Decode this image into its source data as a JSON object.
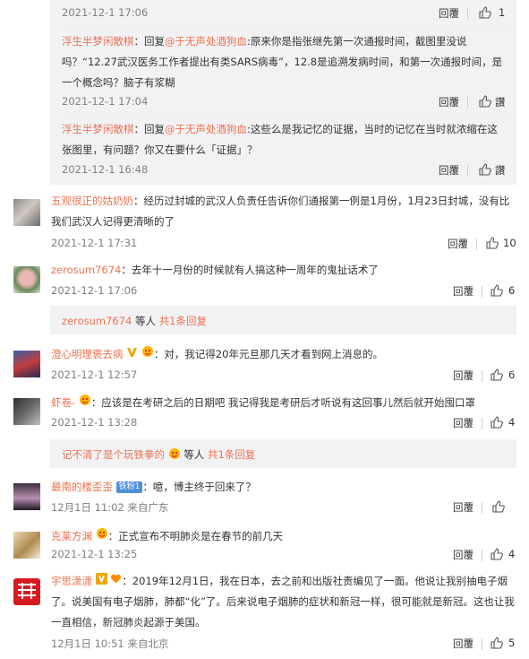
{
  "labels": {
    "reply": "回覆",
    "reply_simplified": "回复",
    "like_text": "讚"
  },
  "thread1": {
    "r0": {
      "time": "2021-12-1 17:06",
      "likes": "1"
    },
    "r1": {
      "user": "浮生半梦闲散棋",
      "prefix": "：回复",
      "mention": "@于无声处酒狗血",
      "body": ":原来你是指张继先第一次通报时间，截图里没说吗？“12.27武汉医务工作者提出有类SARS病毒”，12.8是追溯发病时间，和第一次通报时间，是一个概念吗？脑子有浆糊",
      "time": "2021-12-1 17:04"
    },
    "r2": {
      "user": "浮生半梦闲散棋",
      "prefix": "：回复",
      "mention": "@于无声处酒狗血",
      "body": ":这些么是我记忆的证据，当时的记忆在当时就浓缩在这张图里，有问题？你又在要什么「证据」？",
      "time": "2021-12-1 16:48"
    }
  },
  "comments": [
    {
      "user": "五观很正的姑奶奶",
      "text": "：经历过封城的武汉人负责任告诉你们通报第一例是1月份，1月23日封城，没有比我们武汉人记得更清晰的了",
      "time": "2021-12-1 17:31",
      "likes": "10"
    },
    {
      "user": "zerosum7674",
      "text": "：去年十一月份的时候就有人搞这种一周年的鬼扯话术了",
      "time": "2021-12-1 17:06",
      "likes": "6",
      "more": {
        "user": "zerosum7674",
        "mid": " 等人 ",
        "link": "共1条回复"
      }
    },
    {
      "user": "澄心明理褒去病",
      "text": "：对，我记得20年元旦那几天才看到网上消息的。",
      "time": "2021-12-1 12:57",
      "likes": "6"
    },
    {
      "user": "虾卷-",
      "text": "：应该是在考研之后的日期吧 我记得我是考研后才听说有这回事儿然后就开始囤口罩",
      "time": "2021-12-1 13:28",
      "likes": "4",
      "more": {
        "user": "记不清了是个玩铁拳的",
        "mid": " 等人 ",
        "link": "共1条回复"
      }
    },
    {
      "user": "最南的楼歪歪",
      "badge": "铁粉1",
      "text": "：噫，博主终于回来了？",
      "time": "12月1日 11:02 来自广东",
      "likes": ""
    },
    {
      "user": "克莱方渊",
      "text": "：正式宣布不明肺炎是在春节的前几天",
      "time": "2021-12-1 13:25",
      "likes": "4"
    },
    {
      "user": "宇思潇潇",
      "text": "：2019年12月1日，我在日本，去之前和出版社责编见了一面。他说让我别抽电子烟了。说美国有电子烟肺，肺都“化”了。后来说电子烟肺的症状和新冠一样，很可能就是新冠。这也让我一直相信，新冠肺炎起源于美国。",
      "time": "12月1日 10:51 来自北京",
      "likes": "5"
    }
  ],
  "colors": {
    "username": "#eb7350",
    "reply_bg": "#f2f2f5",
    "text": "#333333",
    "meta": "#808080"
  }
}
